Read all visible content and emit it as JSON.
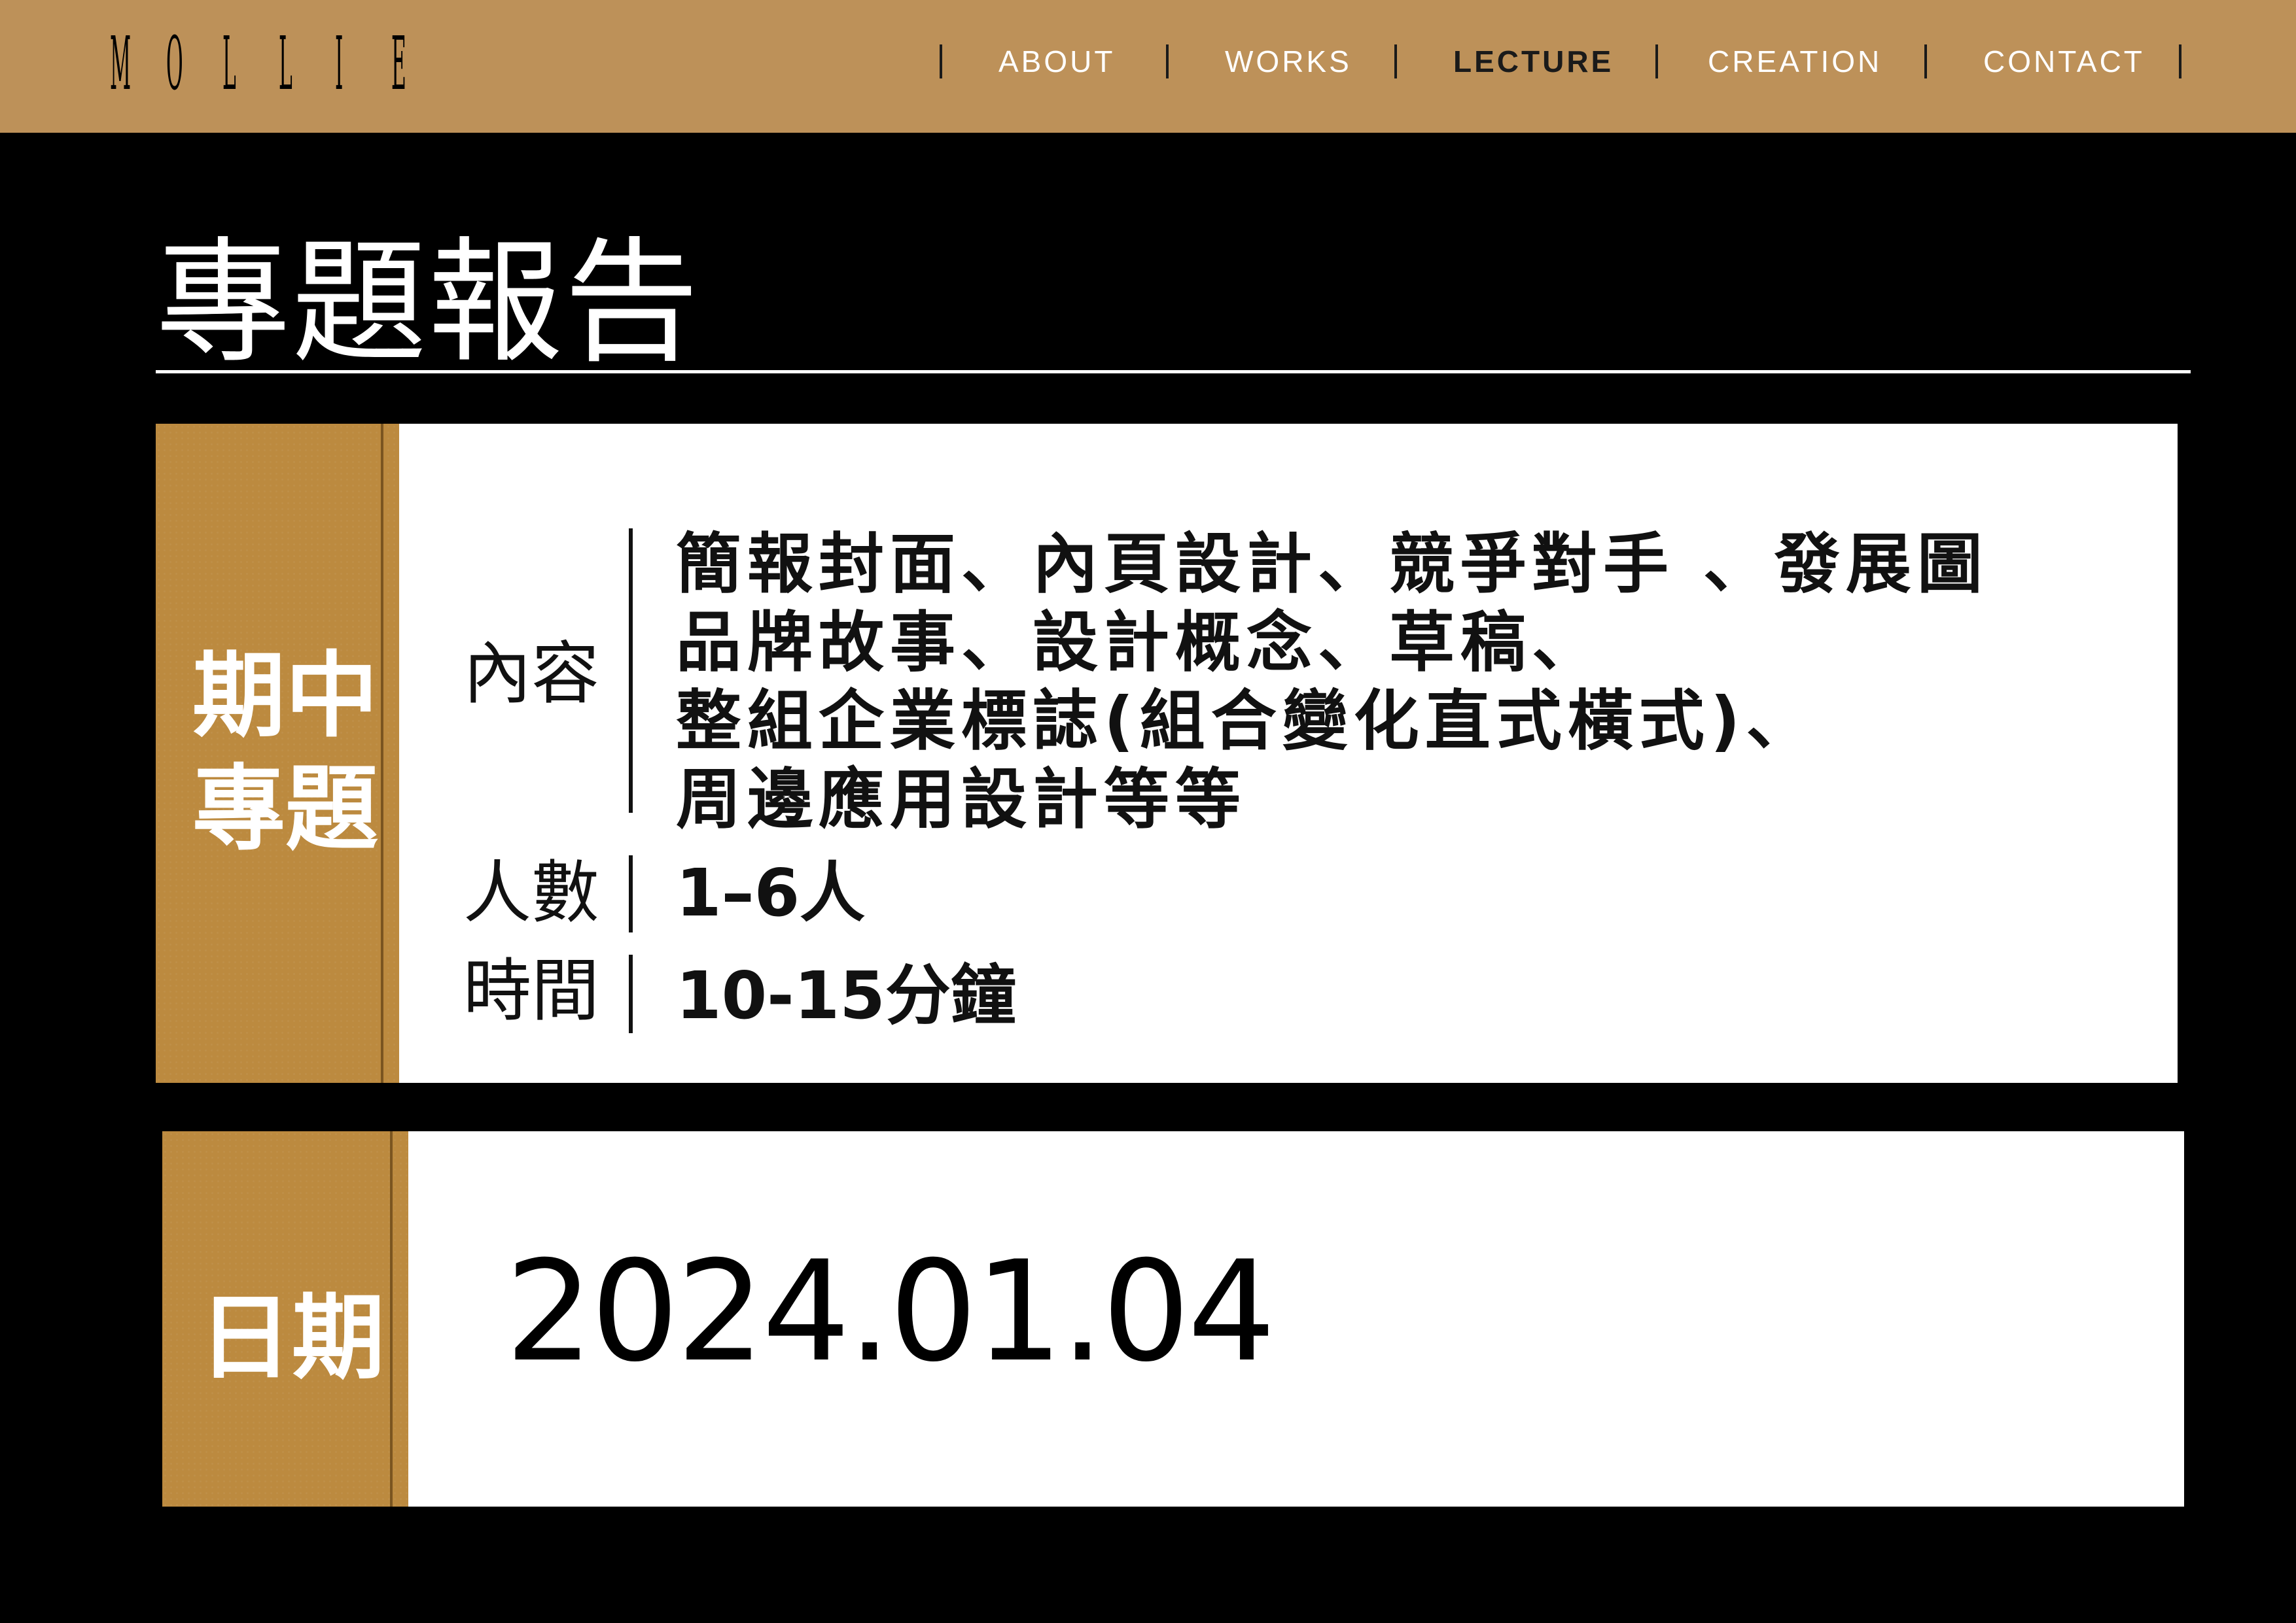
{
  "header": {
    "logo": "MOLLIE",
    "nav": [
      {
        "label": "ABOUT",
        "active": false
      },
      {
        "label": "WORKS",
        "active": false
      },
      {
        "label": "LECTURE",
        "active": true
      },
      {
        "label": "CREATION",
        "active": false
      },
      {
        "label": "CONTACT",
        "active": false
      }
    ]
  },
  "page": {
    "title": "專題報告"
  },
  "midterm": {
    "tab_line1": "期中",
    "tab_line2": "專題",
    "content_label": "內容",
    "content_lines": [
      "簡報封面、內頁設計、競爭對手 、發展圖",
      "品牌故事、設計概念、草稿、",
      "整組企業標誌(組合變化直式橫式)、",
      "周邊應用設計等等"
    ],
    "people_label": "人數",
    "people_value": "1–6人",
    "time_label": "時間",
    "time_value": "10-15分鐘"
  },
  "date_panel": {
    "tab_label": "日期",
    "value": "2024.01.04"
  },
  "colors": {
    "nav_bar": "#bd9159",
    "tab_gold": "#bc8a3f",
    "background": "#000000",
    "panel": "#ffffff"
  }
}
